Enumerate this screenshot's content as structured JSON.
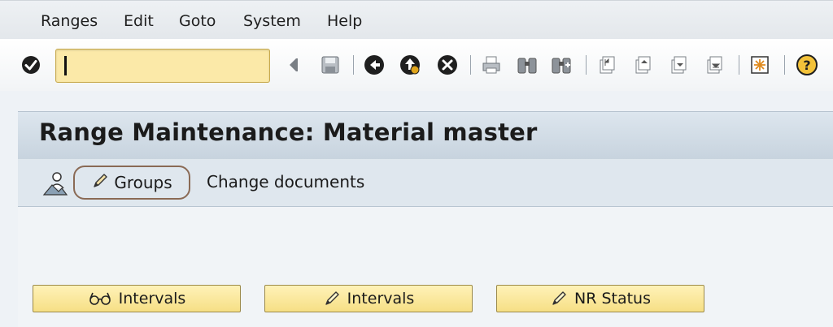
{
  "menubar": {
    "items": [
      "Ranges",
      "Edit",
      "Goto",
      "System",
      "Help"
    ]
  },
  "toolbar": {
    "command_field": {
      "value": "",
      "placeholder": ""
    },
    "icons": [
      "enter-icon",
      "back-nav-icon",
      "save-icon",
      "back-icon",
      "exit-icon",
      "cancel-icon",
      "print-icon",
      "find-icon",
      "find-next-icon",
      "first-page-icon",
      "previous-page-icon",
      "next-page-icon",
      "last-page-icon",
      "create-session-icon",
      "help-icon"
    ]
  },
  "screen": {
    "title": "Range Maintenance: Material master"
  },
  "app_toolbar": {
    "groups_label": "Groups",
    "change_documents_label": "Change documents"
  },
  "buttons": {
    "display_intervals": "Intervals",
    "change_intervals": "Intervals",
    "nr_status": "NR Status"
  },
  "colors": {
    "command_field": "#fbe9a8",
    "title_bar": "#c7d3de",
    "button": "#f6df85",
    "highlight_outline": "#8a6a55"
  }
}
